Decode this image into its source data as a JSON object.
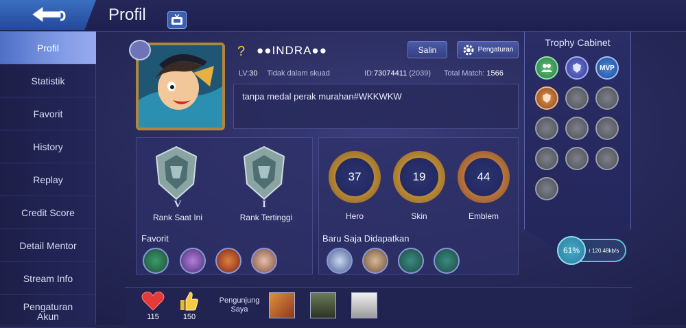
{
  "header": {
    "title": "Profil"
  },
  "sidebar": {
    "items": [
      {
        "label": "Profil",
        "active": true
      },
      {
        "label": "Statistik",
        "active": false
      },
      {
        "label": "Favorit",
        "active": false
      },
      {
        "label": "History",
        "active": false
      },
      {
        "label": "Replay",
        "active": false
      },
      {
        "label": "Credit Score",
        "active": false
      },
      {
        "label": "Detail Mentor",
        "active": false
      },
      {
        "label": "Stream Info",
        "active": false
      },
      {
        "label": "Pengaturan Akun",
        "active": false
      }
    ]
  },
  "profile": {
    "question_mark": "?",
    "username": "●●INDRA●●",
    "copy_label": "Salin",
    "settings_label": "Pengaturan",
    "level_label": "LV:",
    "level": "30",
    "squad": "Tidak dalam skuad",
    "id_label": "ID:",
    "id": "73074411",
    "server": "(2039)",
    "total_match_label": "Total Match:",
    "total_match": "1566",
    "bio": "tanpa medal perak murahan#WKKWKW"
  },
  "ranks": [
    {
      "label": "Rank Saat Ini",
      "numeral": "V"
    },
    {
      "label": "Rank Tertinggi",
      "numeral": "I"
    }
  ],
  "collection": [
    {
      "label": "Hero",
      "value": "37"
    },
    {
      "label": "Skin",
      "value": "19"
    },
    {
      "label": "Emblem",
      "value": "44"
    }
  ],
  "favorit": {
    "title": "Favorit"
  },
  "recent": {
    "title": "Baru Saja Didapatkan"
  },
  "trophy_cabinet": {
    "title": "Trophy Cabinet",
    "mvp_text": "MVP"
  },
  "network": {
    "percent": "61%",
    "speed": "120.48kb/s"
  },
  "bottom": {
    "likes_heart": "115",
    "likes_thumb": "150",
    "visitors_label": "Pengunjung Saya"
  },
  "colors": {
    "accent_blue": "#4f6fc6",
    "gold": "#b0873a",
    "trophy_green": "#3e9a5a",
    "trophy_bronze": "#c9733a"
  }
}
